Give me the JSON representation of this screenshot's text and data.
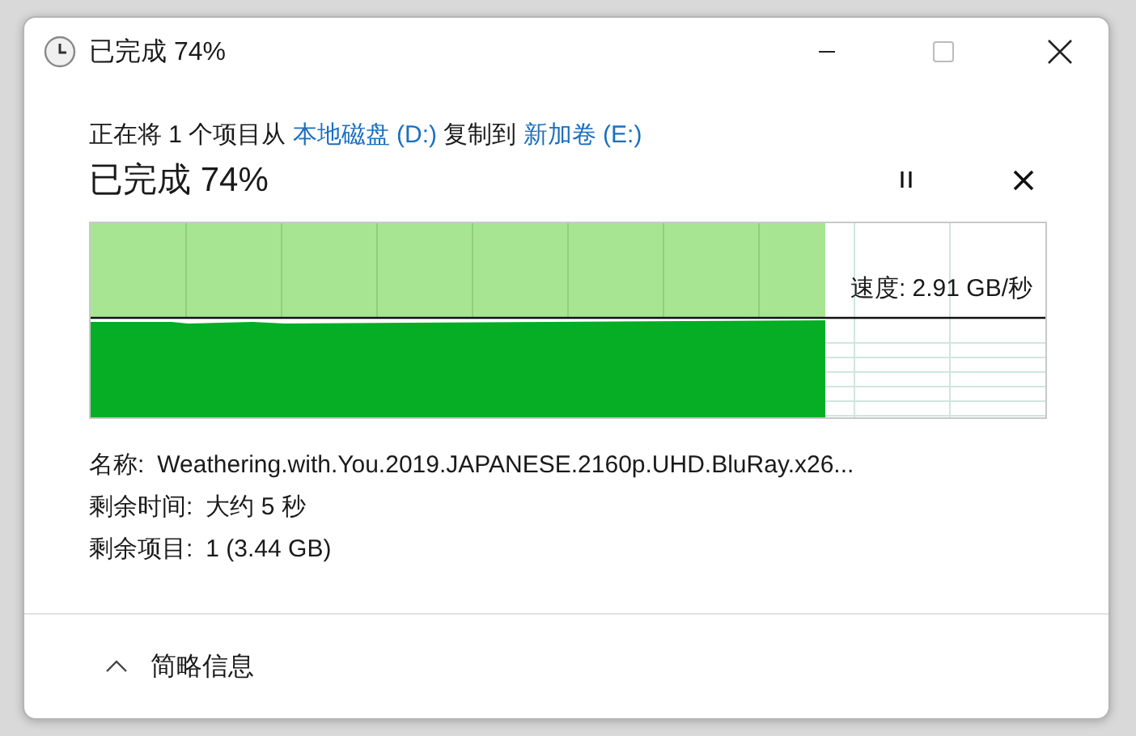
{
  "window": {
    "title": "已完成 74%"
  },
  "header": {
    "parts": [
      {
        "kind": "plain",
        "text": "正在将 1 个项目从 "
      },
      {
        "kind": "link",
        "text": "本地磁盘 (D:)"
      },
      {
        "kind": "plain",
        "text": " 复制到 "
      },
      {
        "kind": "link",
        "text": "新加卷 (E:)"
      }
    ]
  },
  "status": "已完成 74%",
  "progress": {
    "level": 0.77,
    "speed": "速度: 2.91 GB/秒"
  },
  "details": [
    {
      "label": "名称:",
      "value": "Weathering.with.You.2019.JAPANESE.2160p.UHD.BluRay.x26..."
    },
    {
      "label": "剩余时间:",
      "value": "大约 5 秒"
    },
    {
      "label": "剩余项目:",
      "value": "1 (3.44 GB)"
    }
  ],
  "footer": {
    "toggle": "简略信息",
    "expanded": true
  }
}
